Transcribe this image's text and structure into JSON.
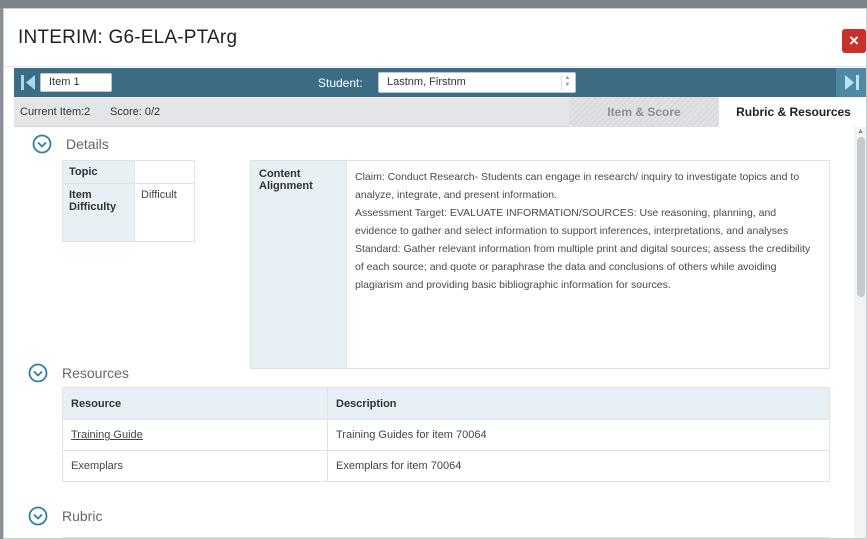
{
  "dialog": {
    "title": "INTERIM: G6-ELA-PTArg",
    "close_label": "×"
  },
  "nav": {
    "item": "Item 1",
    "student_label": "Student:",
    "student_value": "Lastnm, Firstnm"
  },
  "info": {
    "current_item": "Current Item:2",
    "score": "Score: 0/2",
    "tabs": [
      "Item & Score",
      "Rubric & Resources"
    ],
    "active_tab": "Rubric & Resources"
  },
  "details": {
    "heading": "Details",
    "topic_label": "Topic",
    "topic_value": "",
    "difficulty_label": "Item Difficulty",
    "difficulty_value": "Difficult",
    "alignment_label": "Content Alignment",
    "claim": "Claim: Conduct Research- Students can engage in research/ inquiry to investigate topics and to analyze, integrate, and present information.",
    "target": "Assessment Target: EVALUATE INFORMATION/SOURCES: Use reasoning, planning, and evidence to gather and select information to support inferences, interpretations, and analyses",
    "standard": "Standard: Gather relevant information from multiple print and digital sources; assess the credibility of each source; and quote or paraphrase the data and conclusions of others while avoiding plagiarism and providing basic bibliographic information for sources."
  },
  "resources": {
    "heading": "Resources",
    "columns": [
      "Resource",
      "Description"
    ],
    "rows": [
      {
        "resource": "Training Guide",
        "description": "Training Guides for item 70064"
      },
      {
        "resource": "Exemplars",
        "description": "Exemplars for item 70064"
      }
    ]
  },
  "rubric": {
    "heading": "Rubric"
  },
  "icons": {
    "chevron": "chevron-down-circle-icon",
    "prev": "double-chevron-left-icon",
    "next": "double-chevron-right-icon",
    "close": "close-icon"
  },
  "colors": {
    "nav_bar": "#3d6d85",
    "close": "#c8302a",
    "accent": "#2f7fa0",
    "header_cell": "#e6f0f5"
  }
}
